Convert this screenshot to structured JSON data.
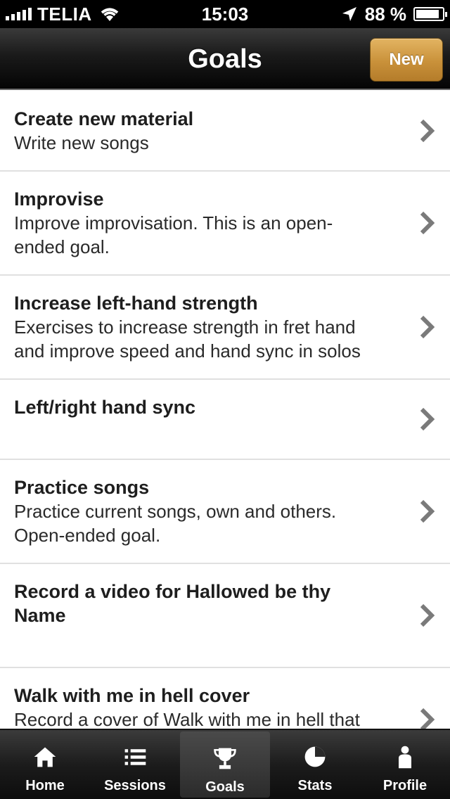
{
  "status_bar": {
    "carrier": "TELIA",
    "time": "15:03",
    "battery_text": "88 %",
    "battery_level": 0.88
  },
  "nav": {
    "title": "Goals",
    "new_label": "New",
    "new_button_color": "#c9913a"
  },
  "goals": [
    {
      "title": "Create new material",
      "desc": "Write new songs"
    },
    {
      "title": "Improvise",
      "desc": "Improve improvisation. This is an open-ended goal."
    },
    {
      "title": "Increase left-hand strength",
      "desc": "Exercises to increase strength in fret hand and improve speed and hand sync in solos"
    },
    {
      "title": "Left/right hand sync",
      "desc": ""
    },
    {
      "title": "Practice songs",
      "desc": "Practice current songs, own and others. Open-ended goal."
    },
    {
      "title": "Record a video for Hallowed be thy Name",
      "desc": ""
    },
    {
      "title": "Walk with me in hell cover",
      "desc": "Record a cover of Walk with me in hell that I'm happy with"
    }
  ],
  "tabs": [
    {
      "label": "Home",
      "icon": "home-icon"
    },
    {
      "label": "Sessions",
      "icon": "list-icon"
    },
    {
      "label": "Goals",
      "icon": "trophy-icon"
    },
    {
      "label": "Stats",
      "icon": "pie-chart-icon"
    },
    {
      "label": "Profile",
      "icon": "person-icon"
    }
  ],
  "active_tab": "Goals"
}
